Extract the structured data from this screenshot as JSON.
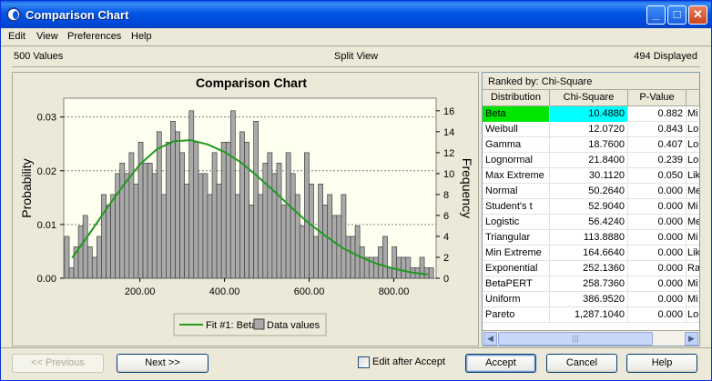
{
  "window": {
    "title": "Comparison Chart"
  },
  "menu": [
    "Edit",
    "View",
    "Preferences",
    "Help"
  ],
  "status": {
    "values": "500 Values",
    "view": "Split View",
    "displayed": "494 Displayed"
  },
  "chart_data": {
    "type": "bar",
    "title": "Comparison Chart",
    "ylabel": "Probability",
    "y2label": "Frequency",
    "xticks": [
      "200.00",
      "400.00",
      "600.00",
      "800.00"
    ],
    "xtick_values": [
      200,
      400,
      600,
      800
    ],
    "yticks": [
      "0.00",
      "0.01",
      "0.02",
      "0.03"
    ],
    "ytick_values": [
      0,
      0.01,
      0.02,
      0.03
    ],
    "y2ticks": [
      "0",
      "2",
      "4",
      "6",
      "8",
      "10",
      "12",
      "14",
      "16"
    ],
    "y2tick_values": [
      0,
      2,
      4,
      6,
      8,
      10,
      12,
      14,
      16
    ],
    "xlim": [
      20,
      900
    ],
    "ylim": [
      0,
      0.0335
    ],
    "y2lim": [
      0,
      17.2
    ],
    "grid": true,
    "legend": {
      "position": "bottom",
      "entries": [
        "Fit #1: Beta",
        "Data values"
      ]
    },
    "bin_width": 10.9,
    "histogram_frequencies": [
      4,
      1,
      3,
      5,
      6,
      3,
      2,
      4,
      8,
      7,
      8,
      10,
      11,
      10,
      12,
      9,
      13,
      11,
      11,
      10,
      14,
      8,
      13,
      15,
      14,
      12,
      9,
      16,
      13,
      10,
      10,
      8,
      12,
      9,
      13,
      13,
      16,
      8,
      14,
      13,
      7,
      15,
      8,
      11,
      12,
      10,
      11,
      7,
      12,
      10,
      8,
      5,
      12,
      9,
      4,
      9,
      7,
      8,
      6,
      6,
      8,
      4,
      4,
      5,
      3,
      2,
      2,
      2,
      3,
      4,
      1,
      3,
      2,
      2,
      2,
      1,
      1,
      2,
      1,
      1
    ],
    "fit_curve": {
      "name": "Fit #1: Beta",
      "color": "#1F9A1F",
      "x": [
        40,
        80,
        120,
        160,
        200,
        240,
        280,
        320,
        360,
        400,
        440,
        480,
        520,
        560,
        600,
        640,
        680,
        720,
        760,
        800,
        840,
        880
      ],
      "y": [
        0.0038,
        0.0082,
        0.0128,
        0.0172,
        0.0212,
        0.024,
        0.0255,
        0.0257,
        0.0249,
        0.0235,
        0.0215,
        0.0188,
        0.016,
        0.013,
        0.0102,
        0.0078,
        0.0056,
        0.004,
        0.0027,
        0.0018,
        0.0011,
        0.0007
      ]
    },
    "bar_color": "#A9A9A9"
  },
  "results": {
    "ranked_by": "Ranked by: Chi-Square",
    "columns": [
      "Distribution",
      "Chi-Square",
      "P-Value"
    ],
    "rows": [
      {
        "name": "Beta",
        "chi": "10.4880",
        "p": "0.882",
        "extra": "Mi"
      },
      {
        "name": "Weibull",
        "chi": "12.0720",
        "p": "0.843",
        "extra": "Lo"
      },
      {
        "name": "Gamma",
        "chi": "18.7600",
        "p": "0.407",
        "extra": "Lo"
      },
      {
        "name": "Lognormal",
        "chi": "21.8400",
        "p": "0.239",
        "extra": "Lo"
      },
      {
        "name": "Max Extreme",
        "chi": "30.1120",
        "p": "0.050",
        "extra": "Lik"
      },
      {
        "name": "Normal",
        "chi": "50.2640",
        "p": "0.000",
        "extra": "Me"
      },
      {
        "name": "Student's t",
        "chi": "52.9040",
        "p": "0.000",
        "extra": "Mi"
      },
      {
        "name": "Logistic",
        "chi": "56.4240",
        "p": "0.000",
        "extra": "Me"
      },
      {
        "name": "Triangular",
        "chi": "113.8880",
        "p": "0.000",
        "extra": "Mi"
      },
      {
        "name": "Min Extreme",
        "chi": "164.6640",
        "p": "0.000",
        "extra": "Lik"
      },
      {
        "name": "Exponential",
        "chi": "252.1360",
        "p": "0.000",
        "extra": "Ra"
      },
      {
        "name": "BetaPERT",
        "chi": "258.7360",
        "p": "0.000",
        "extra": "Mi"
      },
      {
        "name": "Uniform",
        "chi": "386.9520",
        "p": "0.000",
        "extra": "Mi"
      },
      {
        "name": "Pareto",
        "chi": "1,287.1040",
        "p": "0.000",
        "extra": "Lo"
      }
    ],
    "highlight_name_color": "#00E600",
    "highlight_value_color": "#00FFFF"
  },
  "buttons": {
    "previous": "<< Previous",
    "next": "Next >>",
    "edit_after_accept": "Edit after Accept",
    "accept": "Accept",
    "cancel": "Cancel",
    "help": "Help"
  }
}
